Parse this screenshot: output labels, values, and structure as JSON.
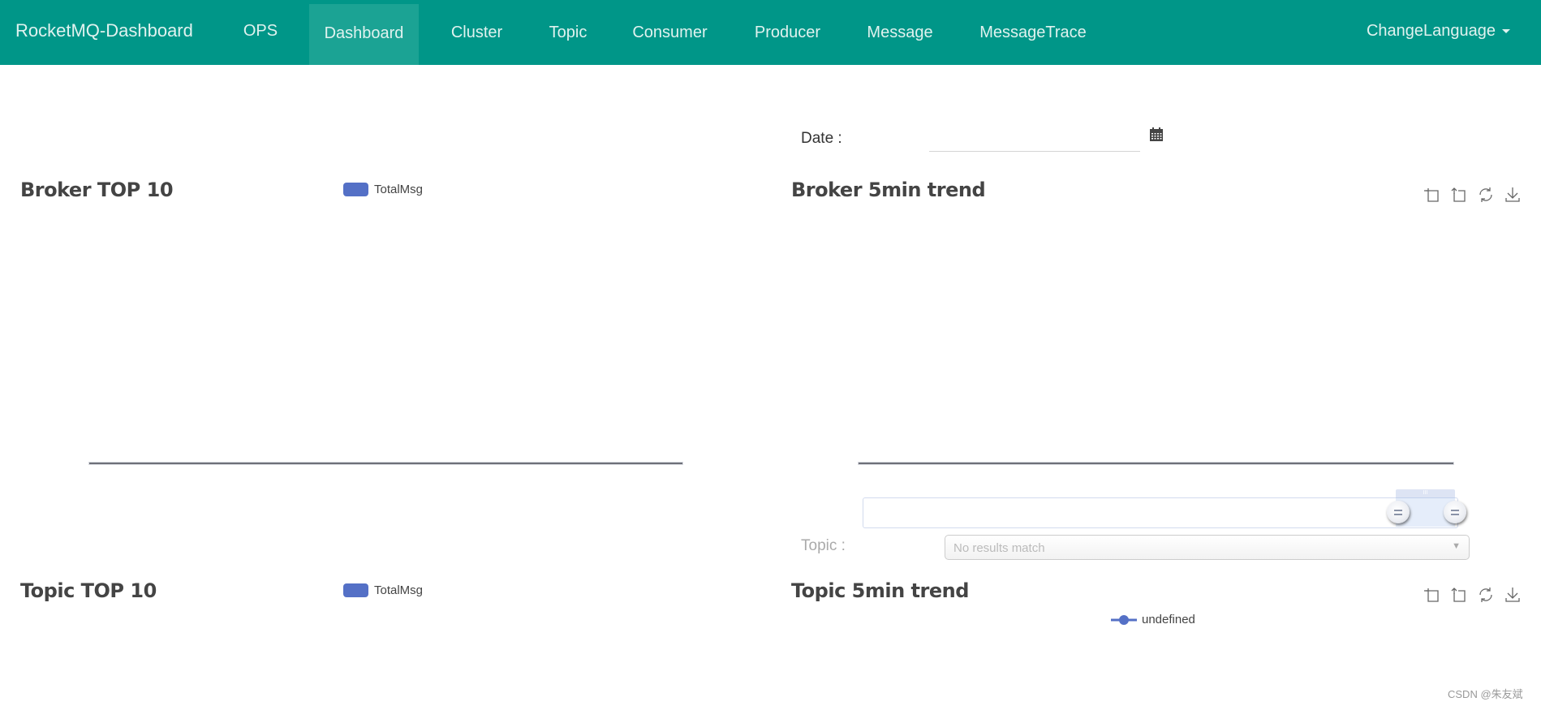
{
  "navbar": {
    "brand": "RocketMQ-Dashboard",
    "items": [
      {
        "label": "OPS",
        "active": false
      },
      {
        "label": "Dashboard",
        "active": true
      },
      {
        "label": "Cluster",
        "active": false
      },
      {
        "label": "Topic",
        "active": false
      },
      {
        "label": "Consumer",
        "active": false
      },
      {
        "label": "Producer",
        "active": false
      },
      {
        "label": "Message",
        "active": false
      },
      {
        "label": "MessageTrace",
        "active": false
      }
    ],
    "language_menu": "ChangeLanguage",
    "background_color": "#009688"
  },
  "date_filter": {
    "label": "Date :",
    "value": "",
    "icon": "calendar-icon"
  },
  "topic_filter": {
    "label": "Topic :",
    "placeholder": "No results match"
  },
  "charts": {
    "broker_top10": {
      "title": "Broker TOP 10",
      "legend": "TotalMsg",
      "series_color": "#5470c6"
    },
    "broker_trend": {
      "title": "Broker 5min trend",
      "toolbox": [
        "zoom-icon",
        "zoom-reset-icon",
        "restore-icon",
        "save-image-icon"
      ]
    },
    "topic_top10": {
      "title": "Topic TOP 10",
      "legend": "TotalMsg",
      "series_color": "#5470c6"
    },
    "topic_trend": {
      "title": "Topic 5min trend",
      "legend": "undefined",
      "toolbox": [
        "zoom-icon",
        "zoom-reset-icon",
        "restore-icon",
        "save-image-icon"
      ]
    }
  },
  "data_zoom": {
    "start_percent": 90,
    "end_percent": 100,
    "handle_label": "III"
  },
  "chart_data": [
    {
      "type": "bar",
      "title": "Broker TOP 10",
      "legend": [
        "TotalMsg"
      ],
      "categories": [],
      "values": []
    },
    {
      "type": "line",
      "title": "Broker 5min trend",
      "series": [],
      "x": []
    },
    {
      "type": "bar",
      "title": "Topic TOP 10",
      "legend": [
        "TotalMsg"
      ],
      "categories": [],
      "values": []
    },
    {
      "type": "line",
      "title": "Topic 5min trend",
      "legend": [
        "undefined"
      ],
      "series": [],
      "x": []
    }
  ],
  "watermark": "CSDN @朱友斌"
}
